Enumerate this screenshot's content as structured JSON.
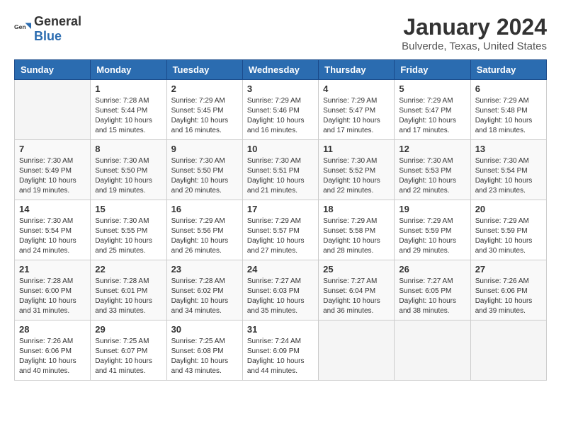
{
  "header": {
    "logo_general": "General",
    "logo_blue": "Blue",
    "month_year": "January 2024",
    "location": "Bulverde, Texas, United States"
  },
  "weekdays": [
    "Sunday",
    "Monday",
    "Tuesday",
    "Wednesday",
    "Thursday",
    "Friday",
    "Saturday"
  ],
  "weeks": [
    [
      {
        "day": "",
        "info": ""
      },
      {
        "day": "1",
        "info": "Sunrise: 7:28 AM\nSunset: 5:44 PM\nDaylight: 10 hours\nand 15 minutes."
      },
      {
        "day": "2",
        "info": "Sunrise: 7:29 AM\nSunset: 5:45 PM\nDaylight: 10 hours\nand 16 minutes."
      },
      {
        "day": "3",
        "info": "Sunrise: 7:29 AM\nSunset: 5:46 PM\nDaylight: 10 hours\nand 16 minutes."
      },
      {
        "day": "4",
        "info": "Sunrise: 7:29 AM\nSunset: 5:47 PM\nDaylight: 10 hours\nand 17 minutes."
      },
      {
        "day": "5",
        "info": "Sunrise: 7:29 AM\nSunset: 5:47 PM\nDaylight: 10 hours\nand 17 minutes."
      },
      {
        "day": "6",
        "info": "Sunrise: 7:29 AM\nSunset: 5:48 PM\nDaylight: 10 hours\nand 18 minutes."
      }
    ],
    [
      {
        "day": "7",
        "info": "Sunrise: 7:30 AM\nSunset: 5:49 PM\nDaylight: 10 hours\nand 19 minutes."
      },
      {
        "day": "8",
        "info": "Sunrise: 7:30 AM\nSunset: 5:50 PM\nDaylight: 10 hours\nand 19 minutes."
      },
      {
        "day": "9",
        "info": "Sunrise: 7:30 AM\nSunset: 5:50 PM\nDaylight: 10 hours\nand 20 minutes."
      },
      {
        "day": "10",
        "info": "Sunrise: 7:30 AM\nSunset: 5:51 PM\nDaylight: 10 hours\nand 21 minutes."
      },
      {
        "day": "11",
        "info": "Sunrise: 7:30 AM\nSunset: 5:52 PM\nDaylight: 10 hours\nand 22 minutes."
      },
      {
        "day": "12",
        "info": "Sunrise: 7:30 AM\nSunset: 5:53 PM\nDaylight: 10 hours\nand 22 minutes."
      },
      {
        "day": "13",
        "info": "Sunrise: 7:30 AM\nSunset: 5:54 PM\nDaylight: 10 hours\nand 23 minutes."
      }
    ],
    [
      {
        "day": "14",
        "info": "Sunrise: 7:30 AM\nSunset: 5:54 PM\nDaylight: 10 hours\nand 24 minutes."
      },
      {
        "day": "15",
        "info": "Sunrise: 7:30 AM\nSunset: 5:55 PM\nDaylight: 10 hours\nand 25 minutes."
      },
      {
        "day": "16",
        "info": "Sunrise: 7:29 AM\nSunset: 5:56 PM\nDaylight: 10 hours\nand 26 minutes."
      },
      {
        "day": "17",
        "info": "Sunrise: 7:29 AM\nSunset: 5:57 PM\nDaylight: 10 hours\nand 27 minutes."
      },
      {
        "day": "18",
        "info": "Sunrise: 7:29 AM\nSunset: 5:58 PM\nDaylight: 10 hours\nand 28 minutes."
      },
      {
        "day": "19",
        "info": "Sunrise: 7:29 AM\nSunset: 5:59 PM\nDaylight: 10 hours\nand 29 minutes."
      },
      {
        "day": "20",
        "info": "Sunrise: 7:29 AM\nSunset: 5:59 PM\nDaylight: 10 hours\nand 30 minutes."
      }
    ],
    [
      {
        "day": "21",
        "info": "Sunrise: 7:28 AM\nSunset: 6:00 PM\nDaylight: 10 hours\nand 31 minutes."
      },
      {
        "day": "22",
        "info": "Sunrise: 7:28 AM\nSunset: 6:01 PM\nDaylight: 10 hours\nand 33 minutes."
      },
      {
        "day": "23",
        "info": "Sunrise: 7:28 AM\nSunset: 6:02 PM\nDaylight: 10 hours\nand 34 minutes."
      },
      {
        "day": "24",
        "info": "Sunrise: 7:27 AM\nSunset: 6:03 PM\nDaylight: 10 hours\nand 35 minutes."
      },
      {
        "day": "25",
        "info": "Sunrise: 7:27 AM\nSunset: 6:04 PM\nDaylight: 10 hours\nand 36 minutes."
      },
      {
        "day": "26",
        "info": "Sunrise: 7:27 AM\nSunset: 6:05 PM\nDaylight: 10 hours\nand 38 minutes."
      },
      {
        "day": "27",
        "info": "Sunrise: 7:26 AM\nSunset: 6:06 PM\nDaylight: 10 hours\nand 39 minutes."
      }
    ],
    [
      {
        "day": "28",
        "info": "Sunrise: 7:26 AM\nSunset: 6:06 PM\nDaylight: 10 hours\nand 40 minutes."
      },
      {
        "day": "29",
        "info": "Sunrise: 7:25 AM\nSunset: 6:07 PM\nDaylight: 10 hours\nand 41 minutes."
      },
      {
        "day": "30",
        "info": "Sunrise: 7:25 AM\nSunset: 6:08 PM\nDaylight: 10 hours\nand 43 minutes."
      },
      {
        "day": "31",
        "info": "Sunrise: 7:24 AM\nSunset: 6:09 PM\nDaylight: 10 hours\nand 44 minutes."
      },
      {
        "day": "",
        "info": ""
      },
      {
        "day": "",
        "info": ""
      },
      {
        "day": "",
        "info": ""
      }
    ]
  ]
}
